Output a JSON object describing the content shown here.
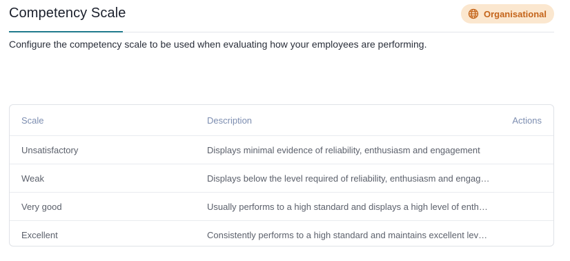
{
  "header": {
    "title": "Competency Scale",
    "badge": {
      "label": "Organisational",
      "icon": "globe-icon",
      "color": "#c4641a",
      "background": "#fbe7cf"
    }
  },
  "description": "Configure the competency scale to be used when evaluating how your employees are performing.",
  "table": {
    "columns": {
      "scale": "Scale",
      "description": "Description",
      "actions": "Actions"
    },
    "rows": [
      {
        "scale": "Unsatisfactory",
        "description": "Displays minimal evidence of reliability, enthusiasm and engagement"
      },
      {
        "scale": "Weak",
        "description": "Displays below the level required of reliability, enthusiasm and engage…"
      },
      {
        "scale": "Very good",
        "description": "Usually performs to a high standard and displays a high level of enthu…"
      },
      {
        "scale": "Excellent",
        "description": "Consistently performs to a high standard and maintains excellent leve…"
      }
    ]
  },
  "colors": {
    "accent": "#1f7a8c",
    "header_text": "#7c8db0"
  }
}
